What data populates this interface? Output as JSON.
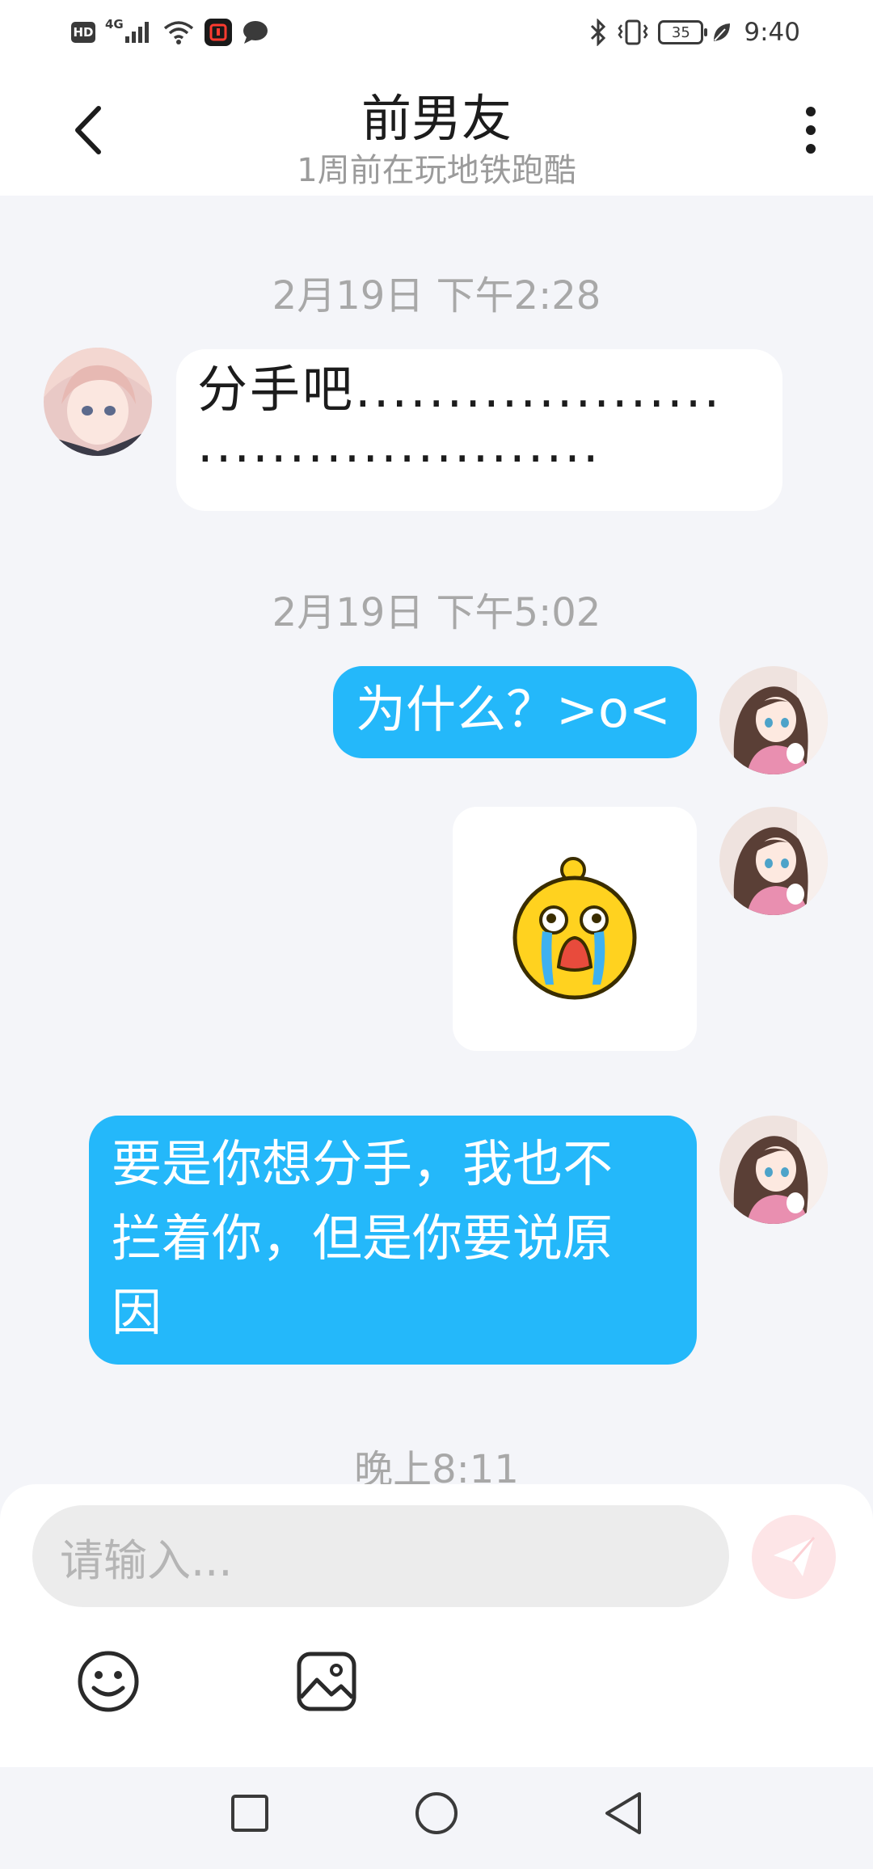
{
  "status_bar": {
    "hd": "HD",
    "network": "4G",
    "battery": "35",
    "time": "9:40",
    "left_icons": [
      "hd-icon",
      "signal-icon",
      "wifi-icon",
      "app-icon",
      "message-icon"
    ],
    "right_icons": [
      "bluetooth-icon",
      "vibrate-icon",
      "battery-icon",
      "leaf-icon"
    ]
  },
  "header": {
    "title": "前男友",
    "subtitle": "1周前在玩地铁跑酷",
    "back_icon": "chevron-left-icon",
    "more_icon": "more-vertical-icon"
  },
  "chat": {
    "timestamp_1": "2月19日 下午2:28",
    "msg_1": {
      "sender": "contact",
      "text_line1": "分手吧....................",
      "text_line2": "......................"
    },
    "timestamp_2": "2月19日 下午5:02",
    "msg_2": {
      "sender": "me",
      "text": "为什么？>o<"
    },
    "msg_3": {
      "sender": "me",
      "sticker": "crying-face-sticker"
    },
    "msg_4": {
      "sender": "me",
      "line1": "要是你想分手，我也不",
      "line2": "拦着你，但是你要说原",
      "line3": "因"
    },
    "timestamp_3": "晚上8:11"
  },
  "composer": {
    "placeholder": "请输入...",
    "send_icon": "send-icon",
    "emoji_icon": "emoji-icon",
    "image_icon": "image-icon"
  },
  "nav_bar": {
    "recents_icon": "square-icon",
    "home_icon": "circle-icon",
    "back_icon": "triangle-back-icon"
  },
  "colors": {
    "outgoing_bubble": "#24b8fa",
    "incoming_bubble": "#ffffff",
    "chat_background": "#f4f5f9",
    "send_button": "#fde5e7"
  }
}
